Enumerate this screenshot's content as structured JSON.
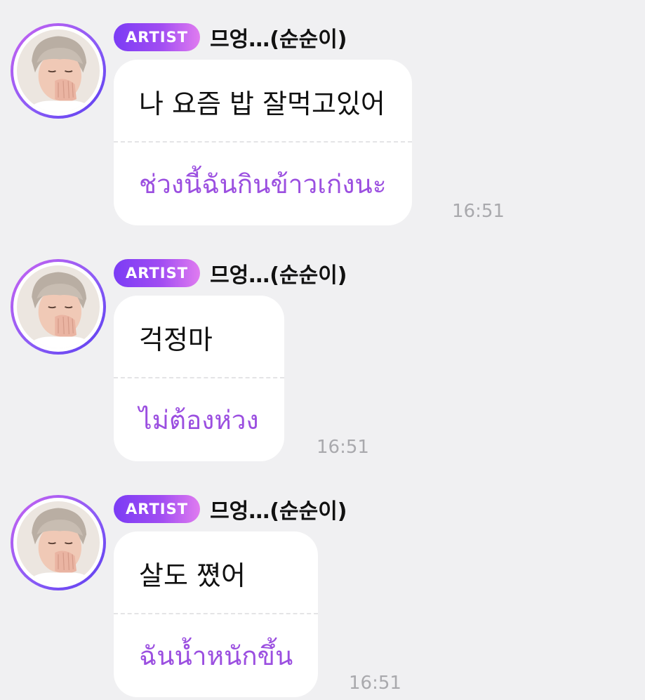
{
  "colors": {
    "background": "#f0f0f2",
    "bubble": "#ffffff",
    "translation_text": "#9b4fe0",
    "timestamp": "#a9a9ad",
    "badge_gradient_start": "#7b3cf5",
    "badge_gradient_end": "#e07cf0"
  },
  "messages": [
    {
      "badge": "ARTIST",
      "sender": "므엉…(순순이)",
      "text": "나 요즘 밥 잘먹고있어",
      "translation": "ช่วงนี้ฉันกินข้าวเก่งนะ",
      "time": "16:51",
      "avatar_icon": "profile-photo"
    },
    {
      "badge": "ARTIST",
      "sender": "므엉…(순순이)",
      "text": "걱정마",
      "translation": "ไม่ต้องห่วง",
      "time": "16:51",
      "avatar_icon": "profile-photo"
    },
    {
      "badge": "ARTIST",
      "sender": "므엉…(순순이)",
      "text": "살도 쪘어",
      "translation": "ฉันน้ำหนักขึ้น",
      "time": "16:51",
      "avatar_icon": "profile-photo"
    }
  ]
}
